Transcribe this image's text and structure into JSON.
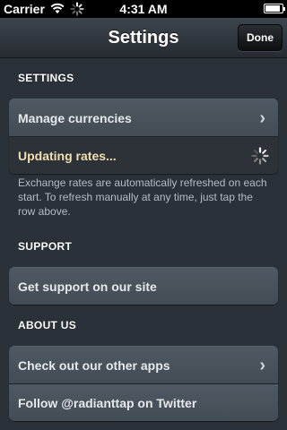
{
  "status_bar": {
    "carrier": "Carrier",
    "time": "4:31 AM",
    "battery_level": 0.9
  },
  "nav": {
    "title": "Settings",
    "done_label": "Done"
  },
  "sections": {
    "settings": {
      "header": "SETTINGS",
      "rows": {
        "manage_currencies": "Manage currencies",
        "updating_rates": "Updating rates..."
      },
      "footer": "Exchange rates are automatically refreshed on each start. To refresh manually at any time, just tap the row above."
    },
    "support": {
      "header": "SUPPORT",
      "rows": {
        "get_support": "Get support on our site"
      }
    },
    "about": {
      "header": "ABOUT US",
      "rows": {
        "other_apps": "Check out our other apps",
        "twitter": "Follow @radianttap on Twitter"
      }
    }
  },
  "colors": {
    "background": "#2b3138",
    "row": "#4a545e",
    "updating_text": "#f0dfaf",
    "footer_text": "#b4bcc4"
  },
  "icons": [
    "wifi-icon",
    "activity-spinner-icon",
    "battery-icon",
    "chevron-right-icon"
  ]
}
